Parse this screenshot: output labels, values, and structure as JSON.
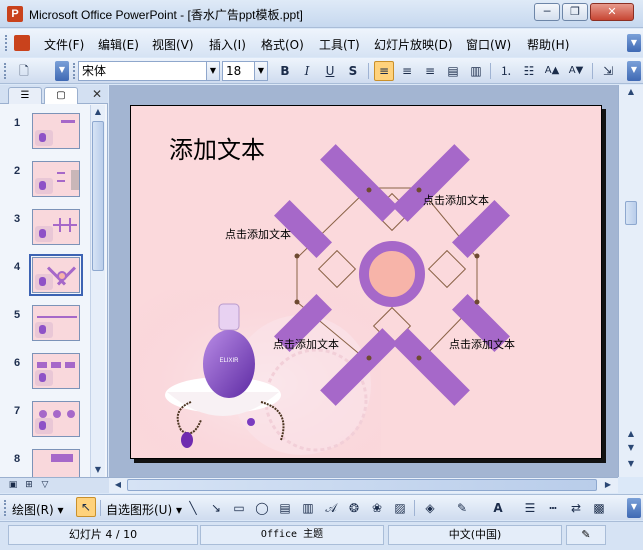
{
  "window": {
    "title": "Microsoft Office PowerPoint - [香水广告ppt模板.ppt]",
    "app_icon_glyph": "P",
    "minimize": "─",
    "restore": "❐",
    "close": "✕"
  },
  "menu": {
    "items": [
      "文件(F)",
      "编辑(E)",
      "视图(V)",
      "插入(I)",
      "格式(O)",
      "工具(T)",
      "幻灯片放映(D)",
      "窗口(W)",
      "帮助(H)"
    ]
  },
  "toolbar": {
    "font_name": "宋体",
    "font_size": "18",
    "bold": "B",
    "italic": "I",
    "underline": "U",
    "shadow": "S",
    "increase_font": "A▲",
    "decrease_font": "A▼"
  },
  "left_pane": {
    "tab_outline": "☰",
    "tab_slides": "▢",
    "close": "✕",
    "thumbnails": [
      "1",
      "2",
      "3",
      "4",
      "5",
      "6",
      "7",
      "8"
    ],
    "selected_index": 4
  },
  "slide": {
    "title": "添加文本",
    "label_top_right": "点击添加文本",
    "label_left": "点击添加文本",
    "label_bottom_left": "点击添加文本",
    "label_bottom_right": "点击添加文本",
    "colors": {
      "background": "#fbd9dc",
      "accent_purple": "#a668c9",
      "circle_fill": "#f7b4a9",
      "line_brown": "#8a6246"
    }
  },
  "draw_toolbar": {
    "draw_label": "绘图(R)",
    "autoshapes_label": "自选图形(U)"
  },
  "status": {
    "slide_info": "幻灯片 4 / 10",
    "theme": "Office 主题",
    "language": "中文(中国)"
  }
}
